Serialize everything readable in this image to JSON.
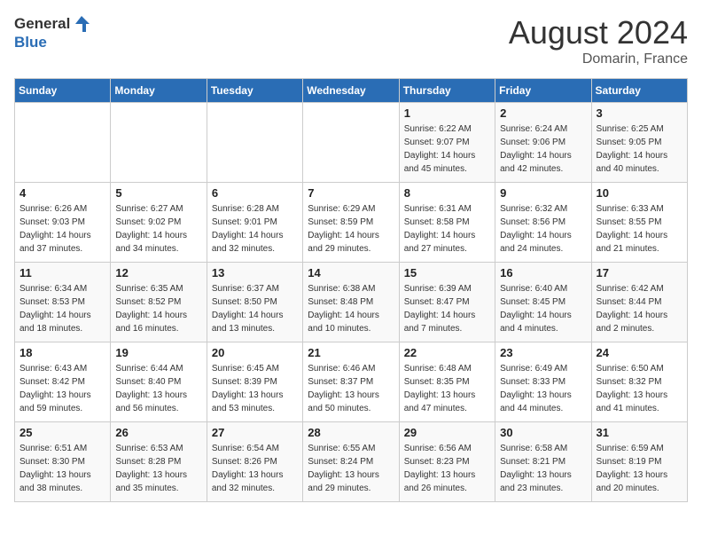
{
  "header": {
    "logo_general": "General",
    "logo_blue": "Blue",
    "month_year": "August 2024",
    "location": "Domarin, France"
  },
  "days_of_week": [
    "Sunday",
    "Monday",
    "Tuesday",
    "Wednesday",
    "Thursday",
    "Friday",
    "Saturday"
  ],
  "weeks": [
    [
      {
        "day": "",
        "info": ""
      },
      {
        "day": "",
        "info": ""
      },
      {
        "day": "",
        "info": ""
      },
      {
        "day": "",
        "info": ""
      },
      {
        "day": "1",
        "info": "Sunrise: 6:22 AM\nSunset: 9:07 PM\nDaylight: 14 hours\nand 45 minutes."
      },
      {
        "day": "2",
        "info": "Sunrise: 6:24 AM\nSunset: 9:06 PM\nDaylight: 14 hours\nand 42 minutes."
      },
      {
        "day": "3",
        "info": "Sunrise: 6:25 AM\nSunset: 9:05 PM\nDaylight: 14 hours\nand 40 minutes."
      }
    ],
    [
      {
        "day": "4",
        "info": "Sunrise: 6:26 AM\nSunset: 9:03 PM\nDaylight: 14 hours\nand 37 minutes."
      },
      {
        "day": "5",
        "info": "Sunrise: 6:27 AM\nSunset: 9:02 PM\nDaylight: 14 hours\nand 34 minutes."
      },
      {
        "day": "6",
        "info": "Sunrise: 6:28 AM\nSunset: 9:01 PM\nDaylight: 14 hours\nand 32 minutes."
      },
      {
        "day": "7",
        "info": "Sunrise: 6:29 AM\nSunset: 8:59 PM\nDaylight: 14 hours\nand 29 minutes."
      },
      {
        "day": "8",
        "info": "Sunrise: 6:31 AM\nSunset: 8:58 PM\nDaylight: 14 hours\nand 27 minutes."
      },
      {
        "day": "9",
        "info": "Sunrise: 6:32 AM\nSunset: 8:56 PM\nDaylight: 14 hours\nand 24 minutes."
      },
      {
        "day": "10",
        "info": "Sunrise: 6:33 AM\nSunset: 8:55 PM\nDaylight: 14 hours\nand 21 minutes."
      }
    ],
    [
      {
        "day": "11",
        "info": "Sunrise: 6:34 AM\nSunset: 8:53 PM\nDaylight: 14 hours\nand 18 minutes."
      },
      {
        "day": "12",
        "info": "Sunrise: 6:35 AM\nSunset: 8:52 PM\nDaylight: 14 hours\nand 16 minutes."
      },
      {
        "day": "13",
        "info": "Sunrise: 6:37 AM\nSunset: 8:50 PM\nDaylight: 14 hours\nand 13 minutes."
      },
      {
        "day": "14",
        "info": "Sunrise: 6:38 AM\nSunset: 8:48 PM\nDaylight: 14 hours\nand 10 minutes."
      },
      {
        "day": "15",
        "info": "Sunrise: 6:39 AM\nSunset: 8:47 PM\nDaylight: 14 hours\nand 7 minutes."
      },
      {
        "day": "16",
        "info": "Sunrise: 6:40 AM\nSunset: 8:45 PM\nDaylight: 14 hours\nand 4 minutes."
      },
      {
        "day": "17",
        "info": "Sunrise: 6:42 AM\nSunset: 8:44 PM\nDaylight: 14 hours\nand 2 minutes."
      }
    ],
    [
      {
        "day": "18",
        "info": "Sunrise: 6:43 AM\nSunset: 8:42 PM\nDaylight: 13 hours\nand 59 minutes."
      },
      {
        "day": "19",
        "info": "Sunrise: 6:44 AM\nSunset: 8:40 PM\nDaylight: 13 hours\nand 56 minutes."
      },
      {
        "day": "20",
        "info": "Sunrise: 6:45 AM\nSunset: 8:39 PM\nDaylight: 13 hours\nand 53 minutes."
      },
      {
        "day": "21",
        "info": "Sunrise: 6:46 AM\nSunset: 8:37 PM\nDaylight: 13 hours\nand 50 minutes."
      },
      {
        "day": "22",
        "info": "Sunrise: 6:48 AM\nSunset: 8:35 PM\nDaylight: 13 hours\nand 47 minutes."
      },
      {
        "day": "23",
        "info": "Sunrise: 6:49 AM\nSunset: 8:33 PM\nDaylight: 13 hours\nand 44 minutes."
      },
      {
        "day": "24",
        "info": "Sunrise: 6:50 AM\nSunset: 8:32 PM\nDaylight: 13 hours\nand 41 minutes."
      }
    ],
    [
      {
        "day": "25",
        "info": "Sunrise: 6:51 AM\nSunset: 8:30 PM\nDaylight: 13 hours\nand 38 minutes."
      },
      {
        "day": "26",
        "info": "Sunrise: 6:53 AM\nSunset: 8:28 PM\nDaylight: 13 hours\nand 35 minutes."
      },
      {
        "day": "27",
        "info": "Sunrise: 6:54 AM\nSunset: 8:26 PM\nDaylight: 13 hours\nand 32 minutes."
      },
      {
        "day": "28",
        "info": "Sunrise: 6:55 AM\nSunset: 8:24 PM\nDaylight: 13 hours\nand 29 minutes."
      },
      {
        "day": "29",
        "info": "Sunrise: 6:56 AM\nSunset: 8:23 PM\nDaylight: 13 hours\nand 26 minutes."
      },
      {
        "day": "30",
        "info": "Sunrise: 6:58 AM\nSunset: 8:21 PM\nDaylight: 13 hours\nand 23 minutes."
      },
      {
        "day": "31",
        "info": "Sunrise: 6:59 AM\nSunset: 8:19 PM\nDaylight: 13 hours\nand 20 minutes."
      }
    ]
  ]
}
